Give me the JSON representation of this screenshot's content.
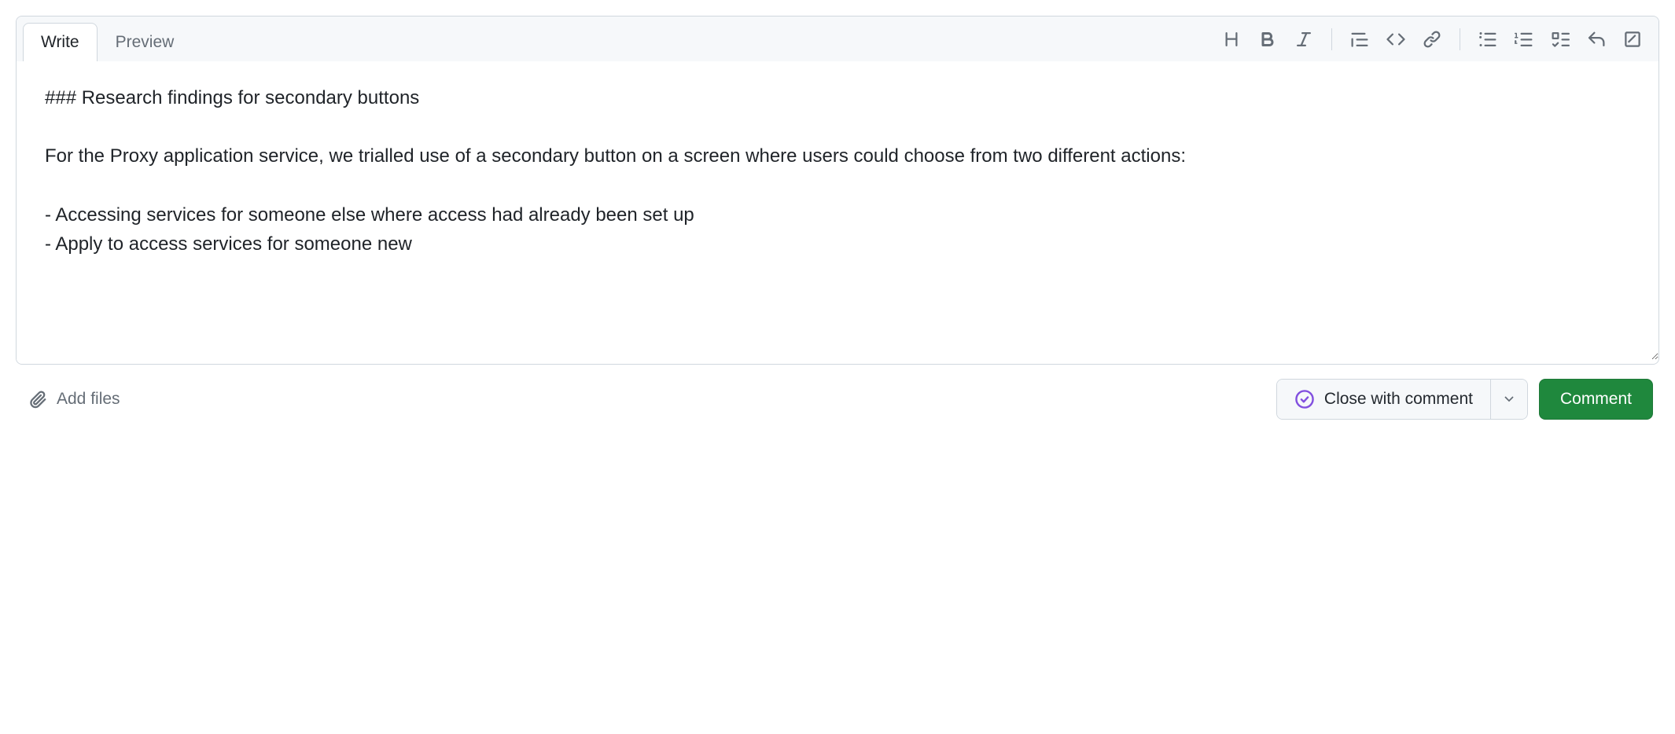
{
  "tabs": {
    "write": "Write",
    "preview": "Preview"
  },
  "editor": {
    "value": "### Research findings for secondary buttons\n\nFor the Proxy application service, we trialled use of a secondary button on a screen where users could choose from two different actions:\n\n- Accessing services for someone else where access had already been set up\n- Apply to access services for someone new"
  },
  "footer": {
    "addFiles": "Add files",
    "closeWithComment": "Close with comment",
    "comment": "Comment"
  },
  "toolbar": {
    "heading": "Heading",
    "bold": "Bold",
    "italic": "Italic",
    "quote": "Quote",
    "code": "Code",
    "link": "Link",
    "ulist": "Unordered list",
    "olist": "Ordered list",
    "tasklist": "Task list",
    "reply": "Reply",
    "slash": "Slash commands"
  }
}
